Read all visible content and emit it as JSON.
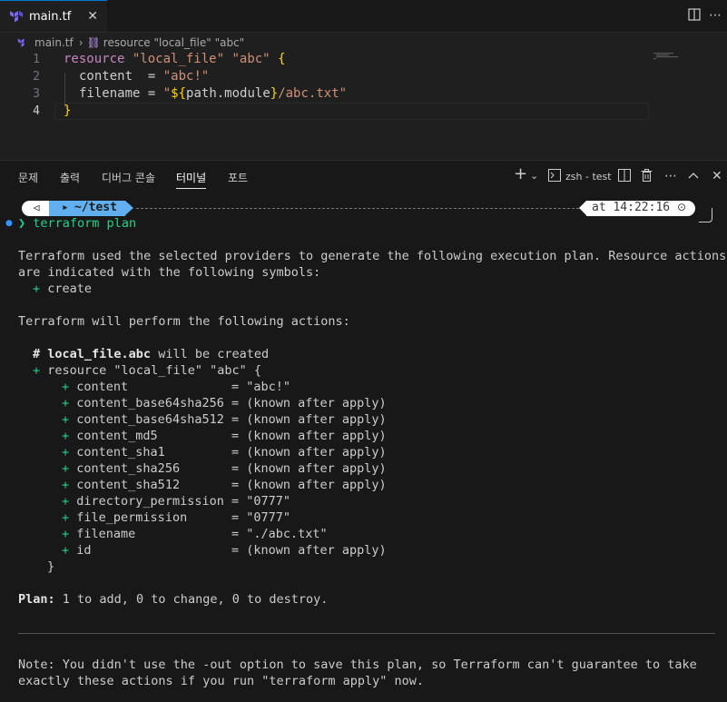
{
  "tab": {
    "filename": "main.tf",
    "close": "✕"
  },
  "breadcrumb": {
    "file": "main.tf",
    "sep": "›",
    "symbol": "resource \"local_file\" \"abc\""
  },
  "editor": {
    "line_numbers": [
      "1",
      "2",
      "3",
      "4"
    ],
    "lines": {
      "l1_kw": "resource",
      "l1_a": "\"local_file\"",
      "l1_b": "\"abc\"",
      "l1_brace": "{",
      "l2_key": "content",
      "l2_eq": "  = ",
      "l2_val": "\"abc!\"",
      "l3_key": "filename",
      "l3_eq": " = ",
      "l3_q1": "\"",
      "l3_interp_open": "${",
      "l3_interp": "path.module",
      "l3_interp_close": "}",
      "l3_rest": "/abc.txt\"",
      "l4_brace": "}"
    }
  },
  "panel": {
    "tabs": [
      "문제",
      "출력",
      "디버그 콘솔",
      "터미널",
      "포트"
    ],
    "active_tab": "터미널",
    "terminal_name": "zsh - test"
  },
  "prompt": {
    "dir": "~/test",
    "time": "at 14:22:16",
    "chevron": "❯",
    "command": "terraform plan"
  },
  "terminal": {
    "t1": "Terraform used the selected providers to generate the following execution plan. Resource actions",
    "t2": "are indicated with the following symbols:",
    "t3_sym": "+",
    "t3": "create",
    "t4": "Terraform will perform the following actions:",
    "t5_hash": "# ",
    "t5_name": "local_file.abc",
    "t5_rest": " will be created",
    "t6_sym": "+",
    "t6": "resource \"local_file\" \"abc\" {",
    "attrs": [
      {
        "sym": "+",
        "text": "content              = \"abc!\""
      },
      {
        "sym": "+",
        "text": "content_base64sha256 = (known after apply)"
      },
      {
        "sym": "+",
        "text": "content_base64sha512 = (known after apply)"
      },
      {
        "sym": "+",
        "text": "content_md5          = (known after apply)"
      },
      {
        "sym": "+",
        "text": "content_sha1         = (known after apply)"
      },
      {
        "sym": "+",
        "text": "content_sha256       = (known after apply)"
      },
      {
        "sym": "+",
        "text": "content_sha512       = (known after apply)"
      },
      {
        "sym": "+",
        "text": "directory_permission = \"0777\""
      },
      {
        "sym": "+",
        "text": "file_permission      = \"0777\""
      },
      {
        "sym": "+",
        "text": "filename             = \"./abc.txt\""
      },
      {
        "sym": "+",
        "text": "id                   = (known after apply)"
      }
    ],
    "close": "}",
    "plan_label": "Plan:",
    "plan_text": " 1 to add, 0 to change, 0 to destroy.",
    "n1": "Note: You didn't use the -out option to save this plan, so Terraform can't guarantee to take",
    "n2": "exactly these actions if you run \"terraform apply\" now."
  }
}
